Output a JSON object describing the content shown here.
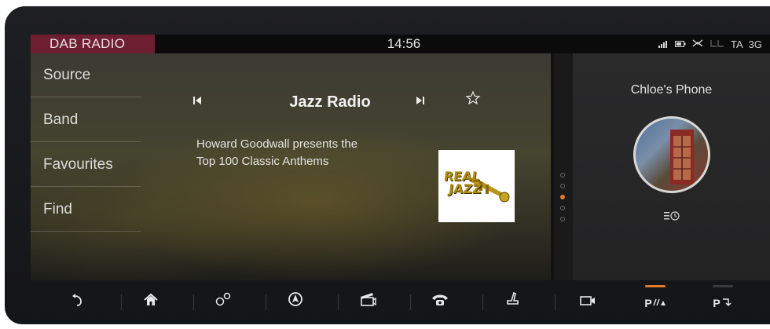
{
  "status_bar": {
    "source_label": "DAB RADIO",
    "time": "14:56",
    "ta": "TA",
    "network": "3G"
  },
  "menu": {
    "items": [
      {
        "label": "Source"
      },
      {
        "label": "Band"
      },
      {
        "label": "Favourites"
      },
      {
        "label": "Find"
      }
    ]
  },
  "now_playing": {
    "station": "Jazz Radio",
    "rds_line1": "Howard Goodwall presents the",
    "rds_line2": "Top 100 Classic Anthems",
    "logo_line1": "REAL",
    "logo_line2": "JAZZ",
    "favourite": false
  },
  "pager": {
    "page_count": 5,
    "active_page": 3
  },
  "phone_panel": {
    "name": "Chloe's Phone"
  },
  "dock": {
    "park_assist_label": "P",
    "park_exit_label": "P"
  },
  "colors": {
    "accent": "#e07a2e",
    "source_tag": "#6e1f31"
  },
  "icons": [
    "back-icon",
    "home-icon",
    "settings-gears-icon",
    "navigation-icon",
    "media-clapper-icon",
    "phone-icon",
    "seat-icon",
    "camera-icon",
    "park-assist-icon",
    "park-exit-icon",
    "signal-icon",
    "battery-icon",
    "bluetooth-icon",
    "seat-status-icon",
    "skip-back-icon",
    "skip-forward-icon",
    "star-icon",
    "recent-calls-icon"
  ]
}
